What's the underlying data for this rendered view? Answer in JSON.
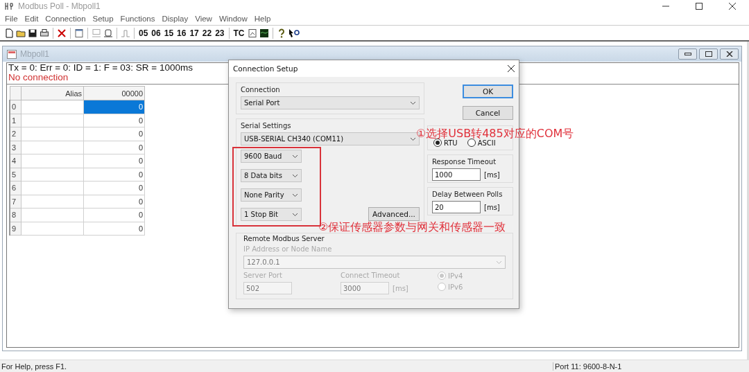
{
  "app_window": {
    "title": "Modbus Poll - Mbpoll1"
  },
  "menu": [
    "File",
    "Edit",
    "Connection",
    "Setup",
    "Functions",
    "Display",
    "View",
    "Window",
    "Help"
  ],
  "toolbar": {
    "function_codes": [
      "05",
      "06",
      "15",
      "16",
      "17",
      "22",
      "23"
    ],
    "traffic_label": "TC"
  },
  "child_window": {
    "title": "Mbpoll1",
    "status_line": "Tx = 0: Err = 0: ID = 1: F = 03: SR = 1000ms",
    "connection_status": "No connection",
    "columns": [
      "Alias",
      "00000"
    ],
    "rows": [
      {
        "index": "0",
        "value": "0",
        "selected": true
      },
      {
        "index": "1",
        "value": "0",
        "selected": false
      },
      {
        "index": "2",
        "value": "0",
        "selected": false
      },
      {
        "index": "3",
        "value": "0",
        "selected": false
      },
      {
        "index": "4",
        "value": "0",
        "selected": false
      },
      {
        "index": "5",
        "value": "0",
        "selected": false
      },
      {
        "index": "6",
        "value": "0",
        "selected": false
      },
      {
        "index": "7",
        "value": "0",
        "selected": false
      },
      {
        "index": "8",
        "value": "0",
        "selected": false
      },
      {
        "index": "9",
        "value": "0",
        "selected": false
      }
    ]
  },
  "dialog": {
    "title": "Connection Setup",
    "connection": {
      "label": "Connection",
      "value": "Serial Port"
    },
    "serial_settings": {
      "label": "Serial Settings",
      "port": "USB-SERIAL CH340 (COM11)",
      "options": [
        "9600 Baud",
        "8 Data bits",
        "None Parity",
        "1 Stop Bit"
      ],
      "advanced_button": "Advanced..."
    },
    "buttons": [
      {
        "label": "OK",
        "default": true
      },
      {
        "label": "Cancel",
        "default": false
      }
    ],
    "mode": {
      "options": [
        {
          "label": "RTU",
          "selected": true
        },
        {
          "label": "ASCII",
          "selected": false
        }
      ]
    },
    "response_timeout": {
      "label": "Response Timeout",
      "value": "1000",
      "unit": "[ms]"
    },
    "delay_between_polls": {
      "label": "Delay Between Polls",
      "value": "20",
      "unit": "[ms]"
    },
    "remote_server": {
      "label": "Remote Modbus Server",
      "disabled": true,
      "address_label": "IP Address or Node Name",
      "address": "127.0.0.1",
      "port_label": "Server Port",
      "port": "502",
      "timeout_label": "Connect Timeout",
      "timeout": "3000",
      "timeout_unit": "[ms]",
      "ip_versions": [
        {
          "label": "IPv4",
          "selected": true
        },
        {
          "label": "IPv6",
          "selected": false
        }
      ]
    }
  },
  "annotations": [
    {
      "text": "①选择USB转485对应的COM号"
    },
    {
      "text": "②保证传感器参数与网关和传感器一致"
    }
  ],
  "status_bar": {
    "help": "For Help, press F1.",
    "port": "Port 11: 9600-8-N-1"
  }
}
